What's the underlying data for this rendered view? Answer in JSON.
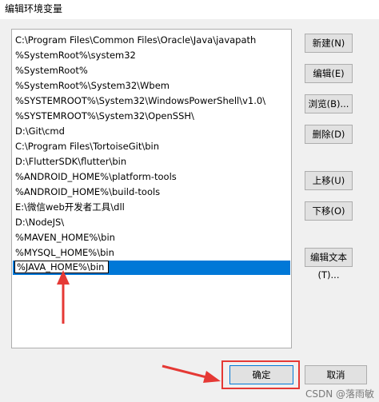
{
  "window": {
    "title": "编辑环境变量"
  },
  "paths": [
    "C:\\Program Files\\Common Files\\Oracle\\Java\\javapath",
    "%SystemRoot%\\system32",
    "%SystemRoot%",
    "%SystemRoot%\\System32\\Wbem",
    "%SYSTEMROOT%\\System32\\WindowsPowerShell\\v1.0\\",
    "%SYSTEMROOT%\\System32\\OpenSSH\\",
    "D:\\Git\\cmd",
    "C:\\Program Files\\TortoiseGit\\bin",
    "D:\\FlutterSDK\\flutter\\bin",
    "%ANDROID_HOME%\\platform-tools",
    "%ANDROID_HOME%\\build-tools",
    "E:\\微信web开发者工具\\dll",
    "D:\\NodeJS\\",
    "%MAVEN_HOME%\\bin",
    "%MYSQL_HOME%\\bin"
  ],
  "editing": {
    "value": "%JAVA_HOME%\\bin"
  },
  "buttons": {
    "new": "新建(N)",
    "edit": "编辑(E)",
    "browse": "浏览(B)...",
    "delete": "删除(D)",
    "move_up": "上移(U)",
    "move_down": "下移(O)",
    "edit_text": "编辑文本(T)...",
    "ok": "确定",
    "cancel": "取消"
  },
  "watermark": "CSDN @落雨敏",
  "colors": {
    "selection": "#0078d7",
    "annotation": "#e53935"
  }
}
